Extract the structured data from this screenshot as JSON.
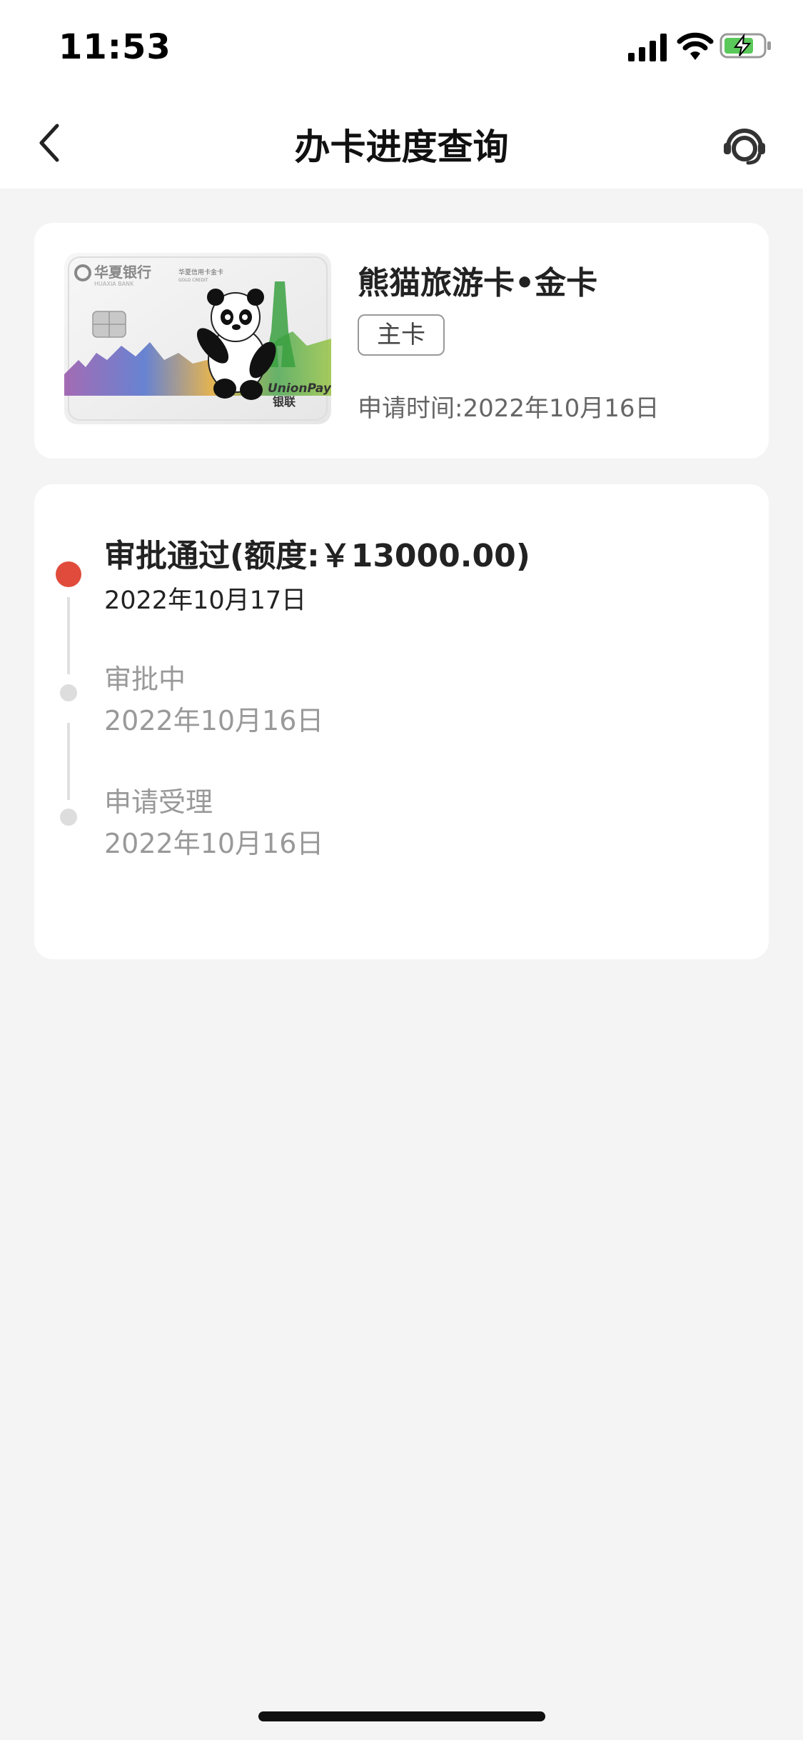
{
  "status_bar": {
    "time": "11:53"
  },
  "nav": {
    "title": "办卡进度查询"
  },
  "card": {
    "name": "熊猫旅游卡•金卡",
    "badge": "主卡",
    "apply_time": "申请时间:2022年10月16日",
    "image": {
      "bank_name_cn": "华夏银行",
      "bank_name_en": "HUAXIA BANK",
      "card_type_cn": "华夏信用卡金卡",
      "card_type_en": "GOLD CREDIT",
      "network_en": "UnionPay",
      "network_cn": "银联"
    }
  },
  "progress": {
    "steps": [
      {
        "title": "审批通过(额度:￥13000.00)",
        "date": "2022年10月17日",
        "status": "active"
      },
      {
        "title": "审批中",
        "date": "2022年10月16日",
        "status": "done"
      },
      {
        "title": "申请受理",
        "date": "2022年10月16日",
        "status": "done"
      }
    ]
  },
  "colors": {
    "accent_red": "#e04b3c",
    "background": "#f4f4f4",
    "battery_green": "#5ac85a"
  },
  "icons": [
    "back-chevron-icon",
    "customer-service-icon",
    "signal-icon",
    "wifi-icon",
    "battery-charging-icon"
  ]
}
